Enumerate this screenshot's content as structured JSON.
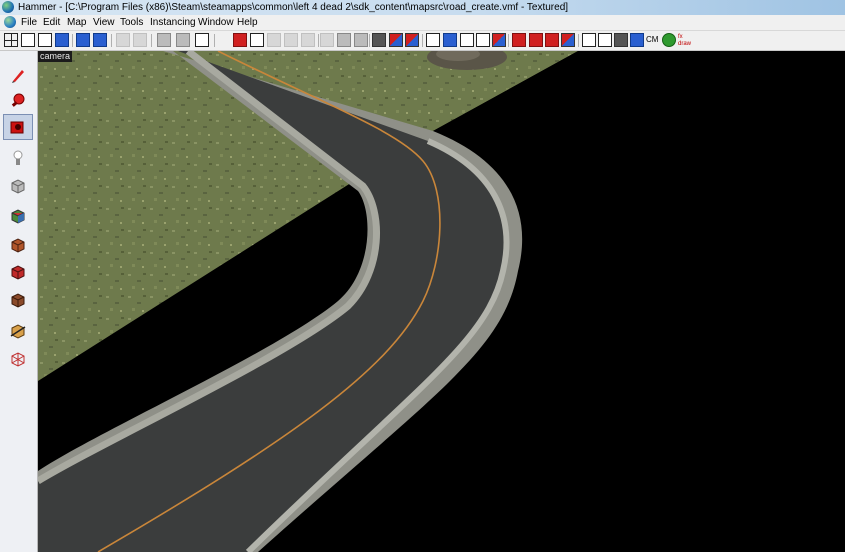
{
  "window": {
    "title": "Hammer - [C:\\Program Files (x86)\\Steam\\steamapps\\common\\left 4 dead 2\\sdk_content\\mapsrc\\road_create.vmf - Textured]"
  },
  "menu": {
    "items": [
      "File",
      "Edit",
      "Map",
      "View",
      "Tools",
      "Instancing",
      "Window",
      "Help"
    ]
  },
  "toolbar": {
    "cm_label": "CM",
    "fx_label": "fx draw"
  },
  "viewport": {
    "label": "camera"
  },
  "tools": [
    "selection-tool",
    "magnify-tool",
    "camera-tool",
    "entity-tool",
    "block-tool",
    "texture-application-tool",
    "apply-current-texture-tool",
    "decal-tool",
    "overlay-tool",
    "clipping-tool",
    "vertex-tool"
  ],
  "colors": {
    "road_center_line": "#c9863a",
    "terrain": "#6f7a4d",
    "asphalt": "#3b3d3d",
    "selected_tool_bg": "#c7d3e6"
  }
}
